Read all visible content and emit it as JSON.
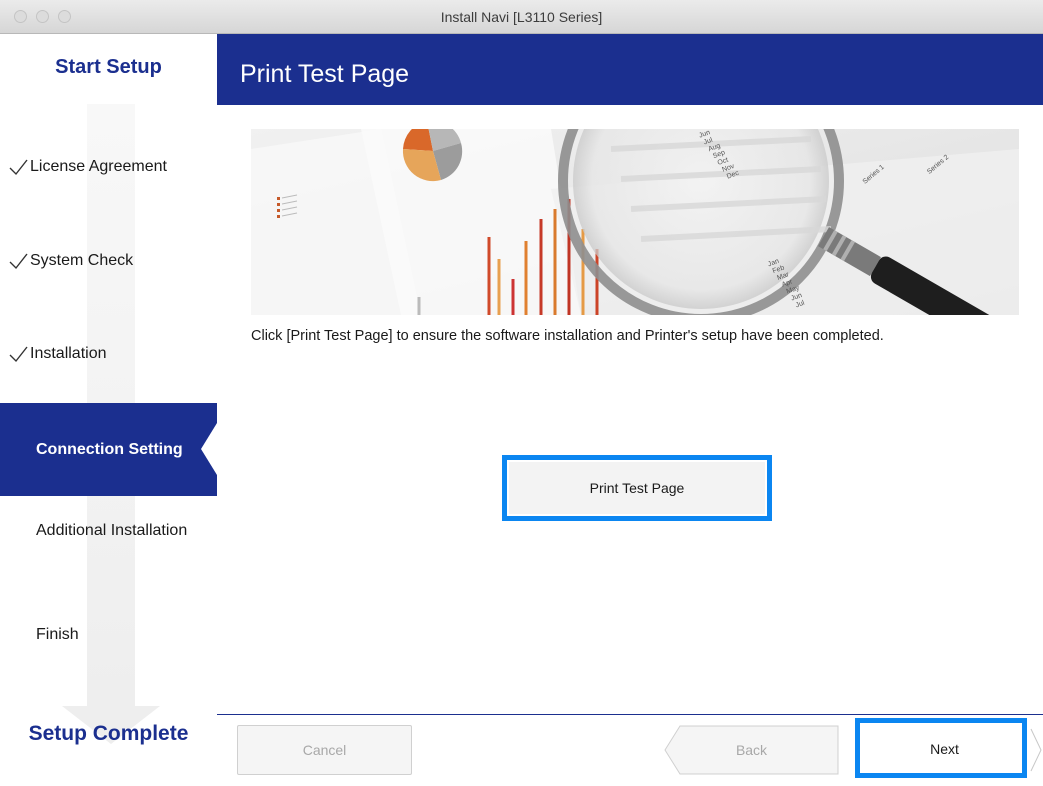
{
  "window": {
    "title": "Install Navi [L3110 Series]"
  },
  "sidebar": {
    "top_title": "Start Setup",
    "bottom_title": "Setup Complete",
    "steps": [
      {
        "label": "License Agreement",
        "completed": true
      },
      {
        "label": "System Check",
        "completed": true
      },
      {
        "label": "Installation",
        "completed": true
      },
      {
        "label": "Connection Setting",
        "active": true
      },
      {
        "label": "Additional Installation"
      },
      {
        "label": "Finish"
      }
    ]
  },
  "main": {
    "title": "Print Test Page",
    "instruction": "Click [Print Test Page] to ensure the software installation and Printer's setup have been completed.",
    "print_button": "Print Test Page",
    "banner": {
      "months_top": [
        "Jun",
        "Jul",
        "Aug",
        "Sep",
        "Oct",
        "Nov",
        "Dec"
      ],
      "months_bottom": [
        "Jan",
        "Feb",
        "Mar",
        "Apr",
        "May",
        "Jun",
        "Jul"
      ],
      "series2_label": "Series 2",
      "series1_label": "Series 1"
    }
  },
  "footer": {
    "cancel": "Cancel",
    "back": "Back",
    "next": "Next"
  },
  "colors": {
    "brand_blue": "#1b2f8f",
    "highlight_blue": "#0b86f1"
  }
}
